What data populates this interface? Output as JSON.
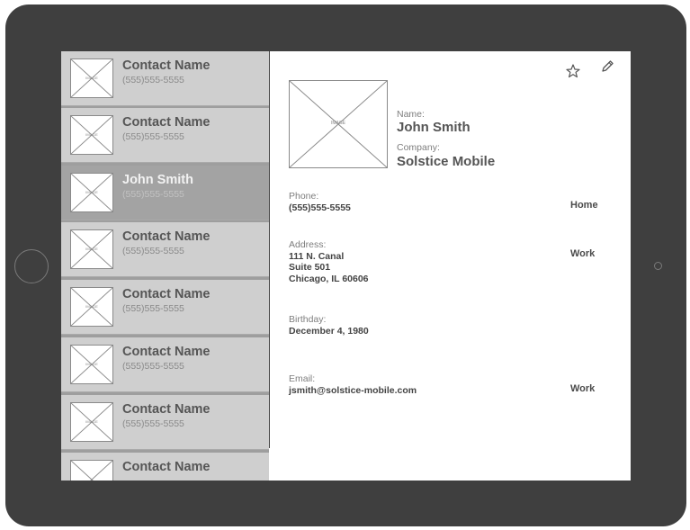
{
  "contacts": [
    {
      "name": "Contact Name",
      "phone": "(555)555-5555",
      "image_label": "IMAGE"
    },
    {
      "name": "Contact Name",
      "phone": "(555)555-5555",
      "image_label": "IMAGE"
    },
    {
      "name": "John Smith",
      "phone": "(555)555-5555",
      "image_label": "IMAGE"
    },
    {
      "name": "Contact Name",
      "phone": "(555)555-5555",
      "image_label": "IMAGE"
    },
    {
      "name": "Contact Name",
      "phone": "(555)555-5555",
      "image_label": "IMAGE"
    },
    {
      "name": "Contact Name",
      "phone": "(555)555-5555",
      "image_label": "IMAGE"
    },
    {
      "name": "Contact Name",
      "phone": "(555)555-5555",
      "image_label": "IMAGE"
    },
    {
      "name": "Contact Name",
      "phone": "",
      "image_label": ""
    }
  ],
  "detail": {
    "photo_label": "IMAGE",
    "icons": {
      "favorite": "star-outline-icon",
      "edit": "pencil-icon"
    },
    "name_label": "Name:",
    "name": "John Smith",
    "company_label": "Company:",
    "company": "Solstice Mobile",
    "phone_label": "Phone:",
    "phone": "(555)555-5555",
    "phone_type": "Home",
    "address_label": "Address:",
    "address_line1": "111 N. Canal",
    "address_line2": "Suite 501",
    "address_line3": "Chicago, IL 60606",
    "address_type": "Work",
    "birthday_label": "Birthday:",
    "birthday": "December 4, 1980",
    "email_label": "Email:",
    "email": "jsmith@solstice-mobile.com",
    "email_type": "Work"
  },
  "colors": {
    "device": "#3f3f3f",
    "row": "#cfcfcf",
    "row_selected": "#a3a3a3"
  }
}
